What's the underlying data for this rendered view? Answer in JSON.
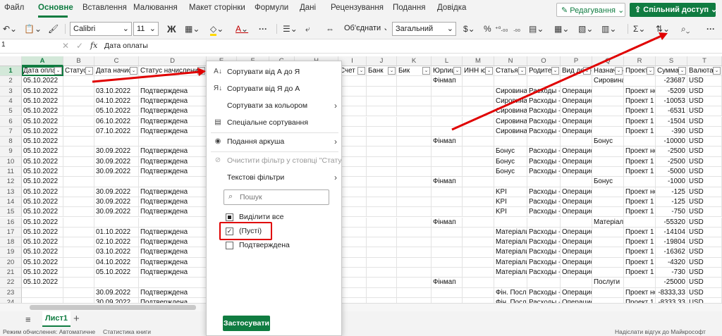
{
  "menu": {
    "tabs": [
      "Файл",
      "Основне",
      "Вставлення",
      "Малювання",
      "Макет сторінки",
      "Формули",
      "Дані",
      "Рецензування",
      "Подання",
      "Довідка"
    ],
    "active_tab": "Основне",
    "edit_mode": "Редагування",
    "share": "Спільний доступ"
  },
  "ribbon": {
    "font_name": "Calibri",
    "font_size": "11",
    "bold": "Ж",
    "merge": "Об'єднати",
    "number_format": "Загальний"
  },
  "formula_bar": {
    "name_box": "1",
    "fx": "fx",
    "content": "Дата оплаты"
  },
  "columns": [
    "A",
    "B",
    "C",
    "D",
    "E",
    "F",
    "G",
    "H",
    "I",
    "J",
    "K",
    "L",
    "M",
    "N",
    "O",
    "P",
    "Q",
    "R",
    "S",
    "T"
  ],
  "headers": {
    "A": "Дата оплаты",
    "B": "Статус",
    "C": "Дата начисл",
    "D": "Статус начисления",
    "I": "Счет",
    "J": "Банк",
    "K": "Бик",
    "L": "Юрлицо",
    "M": "ИНН юр",
    "N": "Статья",
    "O": "Родитель",
    "P": "Вид деятельности",
    "Q": "Назначение",
    "R": "Проект",
    "S": "Сумма",
    "T": "Валюта"
  },
  "rows": [
    {
      "n": "2",
      "A": "05.10.2022",
      "C": "",
      "D": "",
      "L": "Фінмап",
      "N": "",
      "O": "",
      "P": "",
      "Q": "Сировина",
      "R": "",
      "S": "-23687",
      "T": "USD"
    },
    {
      "n": "3",
      "A": "05.10.2022",
      "C": "03.10.2022",
      "D": "Подтверждена",
      "L": "",
      "N": "Сировина",
      "O": "Расходы -",
      "P": "Операционная деят",
      "Q": "",
      "R": "Проект нов",
      "S": "-5209",
      "T": "USD"
    },
    {
      "n": "4",
      "A": "05.10.2022",
      "C": "04.10.2022",
      "D": "Подтверждена",
      "L": "",
      "N": "Сировина",
      "O": "Расходы -",
      "P": "Операционная деят",
      "Q": "",
      "R": "Проект 1",
      "S": "-10053",
      "T": "USD"
    },
    {
      "n": "5",
      "A": "05.10.2022",
      "C": "05.10.2022",
      "D": "Подтверждена",
      "L": "",
      "N": "Сировина",
      "O": "Расходы -",
      "P": "Операционная деят",
      "Q": "",
      "R": "Проект 1",
      "S": "-6531",
      "T": "USD"
    },
    {
      "n": "6",
      "A": "05.10.2022",
      "C": "06.10.2022",
      "D": "Подтверждена",
      "L": "",
      "N": "Сировина",
      "O": "Расходы -",
      "P": "Операционная деят",
      "Q": "",
      "R": "Проект 1",
      "S": "-1504",
      "T": "USD"
    },
    {
      "n": "7",
      "A": "05.10.2022",
      "C": "07.10.2022",
      "D": "Подтверждена",
      "L": "",
      "N": "Сировина",
      "O": "Расходы -",
      "P": "Операционная деят",
      "Q": "",
      "R": "Проект 1",
      "S": "-390",
      "T": "USD"
    },
    {
      "n": "8",
      "A": "05.10.2022",
      "C": "",
      "D": "",
      "L": "Фінмап",
      "N": "",
      "O": "",
      "P": "",
      "Q": "Бонус",
      "R": "",
      "S": "-10000",
      "T": "USD"
    },
    {
      "n": "9",
      "A": "05.10.2022",
      "C": "30.09.2022",
      "D": "Подтверждена",
      "L": "",
      "N": "Бонус",
      "O": "Расходы -",
      "P": "Операционная деят",
      "Q": "",
      "R": "Проект нов",
      "S": "-2500",
      "T": "USD"
    },
    {
      "n": "10",
      "A": "05.10.2022",
      "C": "30.09.2022",
      "D": "Подтверждена",
      "L": "",
      "N": "Бонус",
      "O": "Расходы -",
      "P": "Операционная деят",
      "Q": "",
      "R": "Проект 1",
      "S": "-2500",
      "T": "USD"
    },
    {
      "n": "11",
      "A": "05.10.2022",
      "C": "30.09.2022",
      "D": "Подтверждена",
      "L": "",
      "N": "Бонус",
      "O": "Расходы -",
      "P": "Операционная деят",
      "Q": "",
      "R": "Проект 1",
      "S": "-5000",
      "T": "USD"
    },
    {
      "n": "12",
      "A": "05.10.2022",
      "C": "",
      "D": "",
      "L": "Фінмап",
      "N": "",
      "O": "",
      "P": "",
      "Q": "Бонус",
      "R": "",
      "S": "-1000",
      "T": "USD"
    },
    {
      "n": "13",
      "A": "05.10.2022",
      "C": "30.09.2022",
      "D": "Подтверждена",
      "L": "",
      "N": "KPI",
      "O": "Расходы -",
      "P": "Операционная деят",
      "Q": "",
      "R": "Проект нов",
      "S": "-125",
      "T": "USD"
    },
    {
      "n": "14",
      "A": "05.10.2022",
      "C": "30.09.2022",
      "D": "Подтверждена",
      "L": "",
      "N": "KPI",
      "O": "Расходы -",
      "P": "Операционная деят",
      "Q": "",
      "R": "Проект 1",
      "S": "-125",
      "T": "USD"
    },
    {
      "n": "15",
      "A": "05.10.2022",
      "C": "30.09.2022",
      "D": "Подтверждена",
      "L": "",
      "N": "KPI",
      "O": "Расходы -",
      "P": "Операционная деят",
      "Q": "",
      "R": "Проект 1",
      "S": "-750",
      "T": "USD"
    },
    {
      "n": "16",
      "A": "05.10.2022",
      "C": "",
      "D": "",
      "L": "Фінмап",
      "N": "",
      "O": "",
      "P": "",
      "Q": "Матеріали",
      "R": "",
      "S": "-55320",
      "T": "USD"
    },
    {
      "n": "17",
      "A": "05.10.2022",
      "C": "01.10.2022",
      "D": "Подтверждена",
      "L": "",
      "N": "Матеріали",
      "O": "Расходы -",
      "P": "Операционная деят",
      "Q": "",
      "R": "Проект 1",
      "S": "-14104",
      "T": "USD"
    },
    {
      "n": "18",
      "A": "05.10.2022",
      "C": "02.10.2022",
      "D": "Подтверждена",
      "L": "",
      "N": "Матеріали",
      "O": "Расходы -",
      "P": "Операционная деят",
      "Q": "",
      "R": "Проект 1",
      "S": "-19804",
      "T": "USD"
    },
    {
      "n": "19",
      "A": "05.10.2022",
      "C": "03.10.2022",
      "D": "Подтверждена",
      "L": "",
      "N": "Матеріали",
      "O": "Расходы -",
      "P": "Операционная деят",
      "Q": "",
      "R": "Проект 1",
      "S": "-16362",
      "T": "USD"
    },
    {
      "n": "20",
      "A": "05.10.2022",
      "C": "04.10.2022",
      "D": "Подтверждена",
      "L": "",
      "N": "Матеріали",
      "O": "Расходы -",
      "P": "Операционная деят",
      "Q": "",
      "R": "Проект 1",
      "S": "-4320",
      "T": "USD"
    },
    {
      "n": "21",
      "A": "05.10.2022",
      "C": "05.10.2022",
      "D": "Подтверждена",
      "L": "",
      "N": "Матеріали",
      "O": "Расходы -",
      "P": "Операционная деят",
      "Q": "",
      "R": "Проект 1",
      "S": "-730",
      "T": "USD"
    },
    {
      "n": "22",
      "A": "05.10.2022",
      "C": "",
      "D": "",
      "L": "Фінмап",
      "N": "",
      "O": "",
      "P": "",
      "Q": "Послуги",
      "R": "",
      "S": "-25000",
      "T": "USD"
    },
    {
      "n": "23",
      "A": "",
      "C": "30.09.2022",
      "D": "Подтверждена",
      "L": "",
      "N": "Фін. Посл",
      "O": "Расходы -",
      "P": "Операционная деят",
      "Q": "",
      "R": "Проект нов",
      "S": "-8333,33",
      "T": "USD"
    },
    {
      "n": "24",
      "A": "",
      "C": "30.09.2022",
      "D": "Подтверждена",
      "L": "",
      "N": "Фін. Посл",
      "O": "Расходы -",
      "P": "Операционная деят",
      "Q": "",
      "R": "Проект 1",
      "S": "-8333,33",
      "T": "USD"
    }
  ],
  "dropdown": {
    "sort_az": "Сортувати від А до Я",
    "sort_za": "Сортувати від Я до А",
    "sort_color": "Сортувати за кольором",
    "custom_sort": "Спеціальне сортування",
    "sheet_view": "Подання аркуша",
    "clear_filter": "Очистити фільтр у стовпці \"Статус н",
    "text_filters": "Текстові фільтри",
    "search_placeholder": "Пошук",
    "select_all": "Виділити все",
    "blanks": "(Пусті)",
    "confirmed": "Подтверждена",
    "apply": "Застосувати"
  },
  "sheet_tab": "Лист1",
  "status": {
    "left": "Режим обчислення: Автоматичне",
    "middle": "Статистика книги",
    "right": "Надіслати відгук до Майкрософт"
  },
  "colors": {
    "accent": "#107c41",
    "annotation": "#e00000"
  }
}
